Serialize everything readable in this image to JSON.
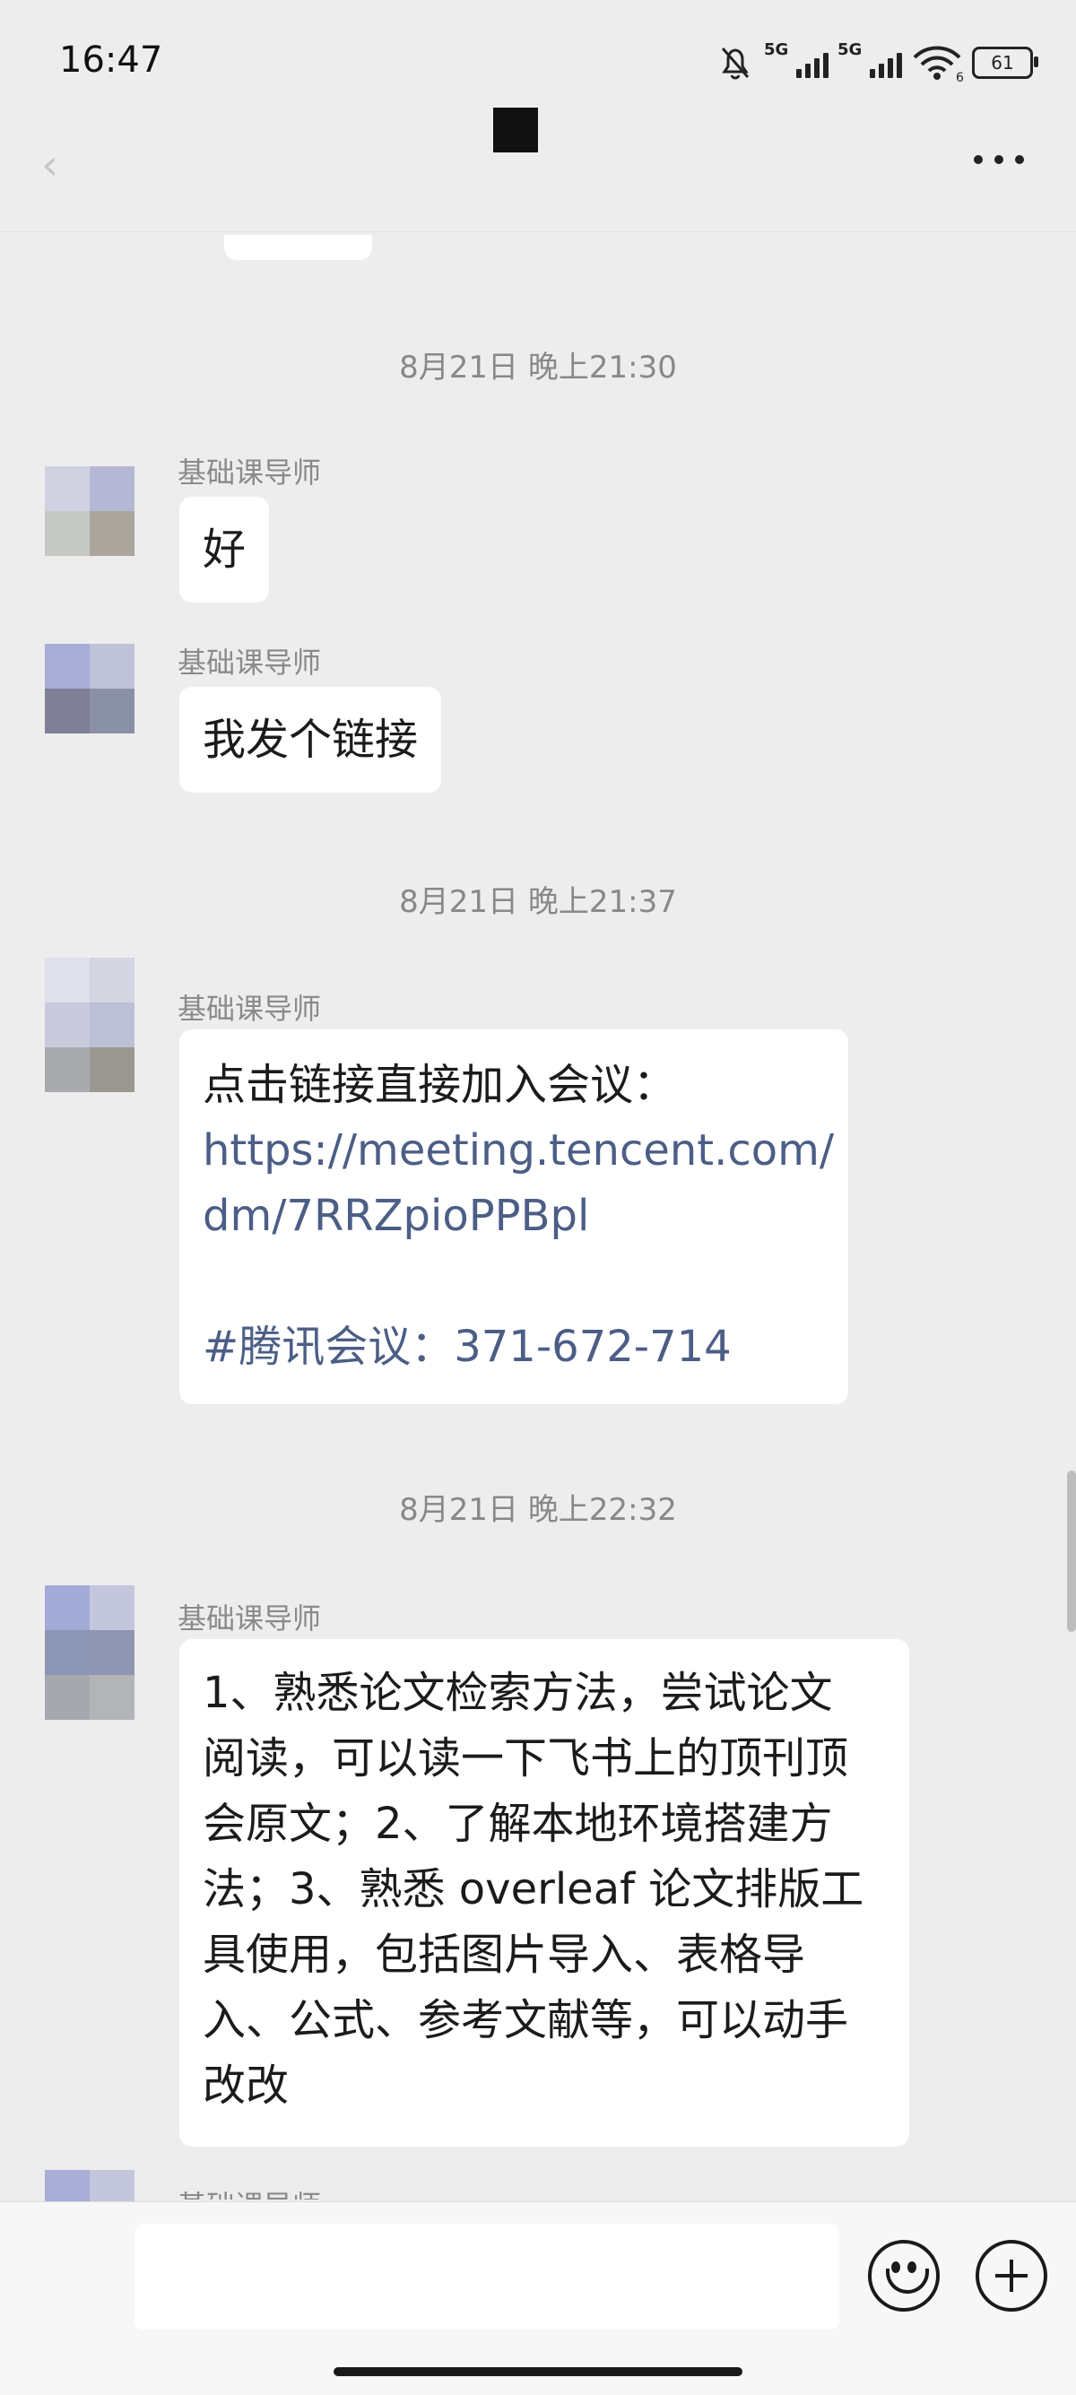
{
  "status_bar": {
    "time": "16:47",
    "signal1": "5G",
    "signal2": "5G",
    "wifi_tag": "6",
    "battery": "61"
  },
  "header": {
    "back_icon": "chevron-left-icon",
    "more_icon": "ellipsis-icon"
  },
  "messages": [
    {
      "timestamp": "8月21日 晚上21:30",
      "sender": "基础课导师",
      "text": "好"
    },
    {
      "sender": "基础课导师",
      "text": "我发个链接"
    },
    {
      "timestamp": "8月21日 晚上21:37",
      "sender": "基础课导师",
      "intro": "点击链接直接加入会议：",
      "link1": "https://meeting.tencent.com/",
      "link2": "dm/7RRZpioPPBpl",
      "meeting": "#腾讯会议：371-672-714"
    },
    {
      "timestamp": "8月21日 晚上22:32",
      "sender": "基础课导师",
      "lines": [
        "1、熟悉论文检索方法，尝试论文",
        "阅读，可以读一下飞书上的顶刊顶",
        "会原文；2、了解本地环境搭建方",
        "法；3、熟悉 overleaf 论文排版工",
        "具使用，包括图片导入、表格导",
        "入、公式、参考文献等，可以动手",
        "改改"
      ]
    },
    {
      "sender": "基础课导师"
    }
  ],
  "input_bar": {
    "emoji_icon": "smiley-icon",
    "plus_icon": "plus-circle-icon"
  }
}
